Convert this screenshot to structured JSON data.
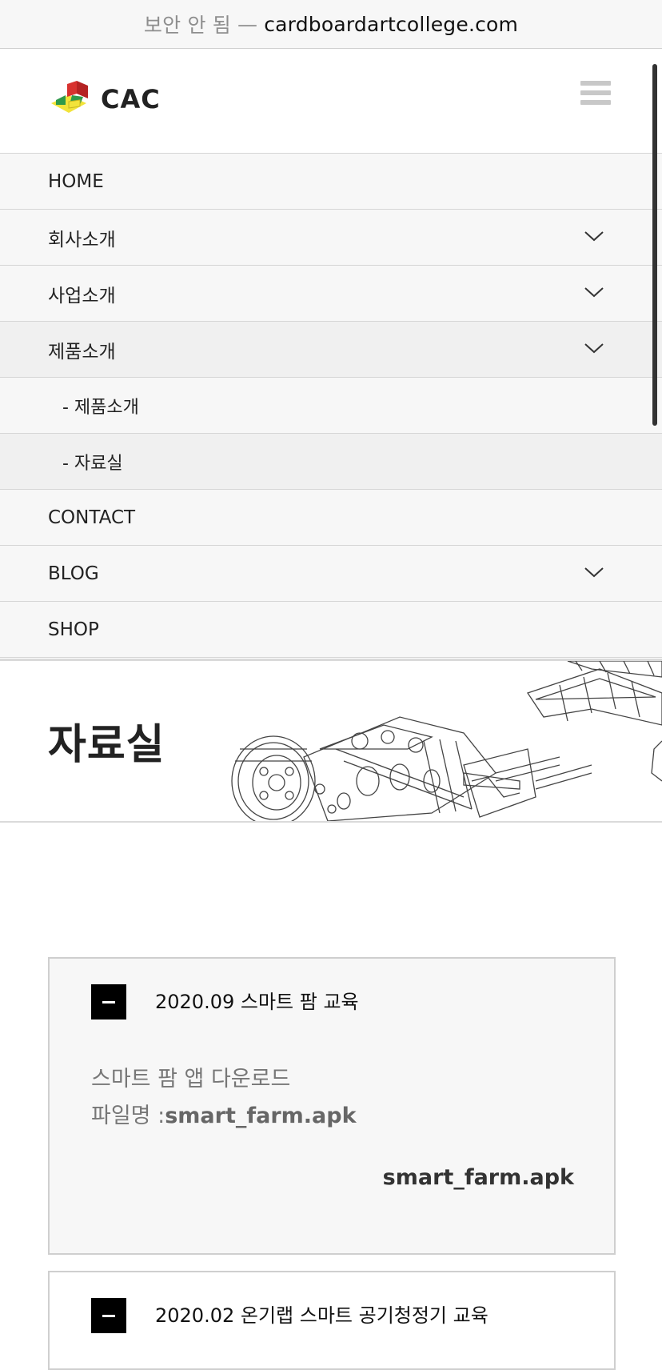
{
  "browser": {
    "secure_label": "보안 안 됨",
    "separator": "—",
    "domain": "cardboardartcollege.com"
  },
  "header": {
    "logo_text": "CAC"
  },
  "menu": {
    "items": [
      {
        "label": "HOME",
        "has_dropdown": false
      },
      {
        "label": "회사소개",
        "has_dropdown": true
      },
      {
        "label": "사업소개",
        "has_dropdown": true
      },
      {
        "label": "제품소개",
        "has_dropdown": true
      },
      {
        "label": "- 제품소개",
        "has_dropdown": false
      },
      {
        "label": "- 자료실",
        "has_dropdown": false
      },
      {
        "label": "CONTACT",
        "has_dropdown": false
      },
      {
        "label": "BLOG",
        "has_dropdown": true
      },
      {
        "label": "SHOP",
        "has_dropdown": false
      }
    ]
  },
  "banner": {
    "title": "자료실"
  },
  "downloads": [
    {
      "title": "2020.09 스마트 팜 교육",
      "description": "스마트 팜 앱 다운로드",
      "filename_prefix": "파일명 :",
      "filename": "smart_farm.apk",
      "link_label": "smart_farm.apk"
    },
    {
      "title": "2020.02 온기랩 스마트 공기청정기 교육"
    }
  ],
  "colors": {
    "logo_red": "#d8322f",
    "logo_green": "#2f9a4a",
    "logo_yellow": "#f2e33a",
    "toggle_bg": "#000000"
  }
}
